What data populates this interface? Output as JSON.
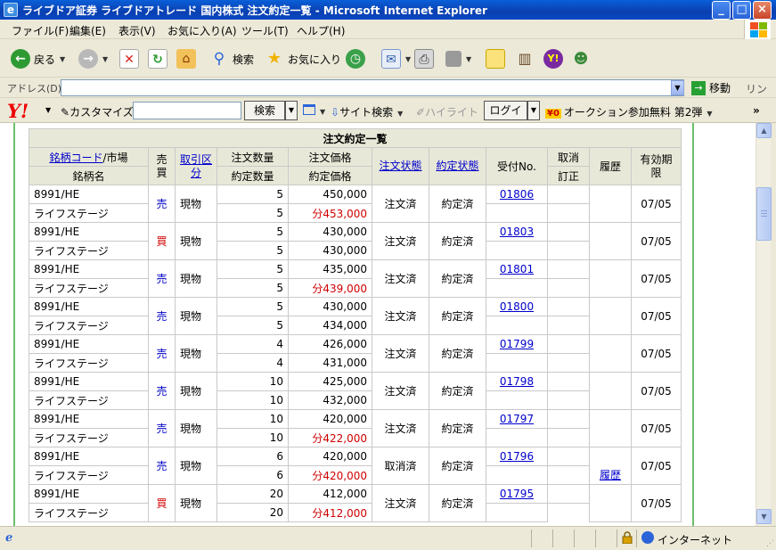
{
  "window": {
    "title": "ライブドア証券 ライブドアトレード 国内株式 注文約定一覧 - Microsoft Internet Explorer"
  },
  "menu": [
    "ファイル(F)",
    "編集(E)",
    "表示(V)",
    "お気に入り(A)",
    "ツール(T)",
    "ヘルプ(H)"
  ],
  "toolbar": {
    "back": "戻る",
    "search": "検索",
    "favorites": "お気に入り"
  },
  "address": {
    "label": "アドレス(D)",
    "value": "",
    "go": "移動",
    "links": "リンク"
  },
  "yahoo": {
    "logo": "Y!",
    "customize": "カスタマイズ",
    "search_button": "検索",
    "site_search": "サイト検索",
    "highlight": "ハイライト",
    "login": "ログイン",
    "auction_icon": "¥0",
    "auction": "オークション参加無料 第2弾",
    "more": "»"
  },
  "table": {
    "caption": "注文約定一覧",
    "headers": {
      "code_link": "銘柄コード",
      "market": "/市場",
      "name": "銘柄名",
      "side": "売買",
      "trade_type": "取引区分",
      "order_qty": "注文数量",
      "exec_qty": "約定数量",
      "order_price": "注文価格",
      "exec_price": "約定価格",
      "order_status": "注文状態",
      "exec_status": "約定状態",
      "receipt": "受付No.",
      "cancel": "取消",
      "modify": "訂正",
      "history": "履歴",
      "expiry": "有効期限"
    },
    "rows": [
      {
        "code": "8991/HE",
        "name": "ライフステージ",
        "side": "売",
        "side_type": "sell",
        "trade": "現物",
        "order_qty": "5",
        "exec_qty": "5",
        "order_price": "450,000",
        "exec_price": "分453,000",
        "exec_red": true,
        "order_status": "注文済",
        "exec_status": "約定済",
        "receipt": "01806",
        "history": "",
        "expiry": "07/05"
      },
      {
        "code": "8991/HE",
        "name": "ライフステージ",
        "side": "買",
        "side_type": "buy",
        "trade": "現物",
        "order_qty": "5",
        "exec_qty": "5",
        "order_price": "430,000",
        "exec_price": "430,000",
        "exec_red": false,
        "order_status": "注文済",
        "exec_status": "約定済",
        "receipt": "01803",
        "history": "",
        "expiry": "07/05"
      },
      {
        "code": "8991/HE",
        "name": "ライフステージ",
        "side": "売",
        "side_type": "sell",
        "trade": "現物",
        "order_qty": "5",
        "exec_qty": "5",
        "order_price": "435,000",
        "exec_price": "分439,000",
        "exec_red": true,
        "order_status": "注文済",
        "exec_status": "約定済",
        "receipt": "01801",
        "history": "",
        "expiry": "07/05"
      },
      {
        "code": "8991/HE",
        "name": "ライフステージ",
        "side": "売",
        "side_type": "sell",
        "trade": "現物",
        "order_qty": "5",
        "exec_qty": "5",
        "order_price": "430,000",
        "exec_price": "434,000",
        "exec_red": false,
        "order_status": "注文済",
        "exec_status": "約定済",
        "receipt": "01800",
        "history": "",
        "expiry": "07/05"
      },
      {
        "code": "8991/HE",
        "name": "ライフステージ",
        "side": "売",
        "side_type": "sell",
        "trade": "現物",
        "order_qty": "4",
        "exec_qty": "4",
        "order_price": "426,000",
        "exec_price": "431,000",
        "exec_red": false,
        "order_status": "注文済",
        "exec_status": "約定済",
        "receipt": "01799",
        "history": "",
        "expiry": "07/05"
      },
      {
        "code": "8991/HE",
        "name": "ライフステージ",
        "side": "売",
        "side_type": "sell",
        "trade": "現物",
        "order_qty": "10",
        "exec_qty": "10",
        "order_price": "425,000",
        "exec_price": "432,000",
        "exec_red": false,
        "order_status": "注文済",
        "exec_status": "約定済",
        "receipt": "01798",
        "history": "",
        "expiry": "07/05"
      },
      {
        "code": "8991/HE",
        "name": "ライフステージ",
        "side": "売",
        "side_type": "sell",
        "trade": "現物",
        "order_qty": "10",
        "exec_qty": "10",
        "order_price": "420,000",
        "exec_price": "分422,000",
        "exec_red": true,
        "order_status": "注文済",
        "exec_status": "約定済",
        "receipt": "01797",
        "history": "",
        "expiry": "07/05"
      },
      {
        "code": "8991/HE",
        "name": "ライフステージ",
        "side": "売",
        "side_type": "sell",
        "trade": "現物",
        "order_qty": "6",
        "exec_qty": "6",
        "order_price": "420,000",
        "exec_price": "分420,000",
        "exec_red": true,
        "order_status": "取消済",
        "exec_status": "約定済",
        "receipt": "01796",
        "history": "履歴",
        "expiry": "07/05"
      },
      {
        "code": "8991/HE",
        "name": "ライフステージ",
        "side": "買",
        "side_type": "buy",
        "trade": "現物",
        "order_qty": "20",
        "exec_qty": "20",
        "order_price": "412,000",
        "exec_price": "分412,000",
        "exec_red": true,
        "order_status": "注文済",
        "exec_status": "約定済",
        "receipt": "01795",
        "history": "",
        "expiry": "07/05"
      }
    ]
  },
  "status": {
    "zone": "インターネット"
  },
  "colors": {
    "sell": "#0000c8",
    "buy": "#d00000",
    "header_bg": "#e8e8d8",
    "frame_green": "#6cbf6c"
  }
}
